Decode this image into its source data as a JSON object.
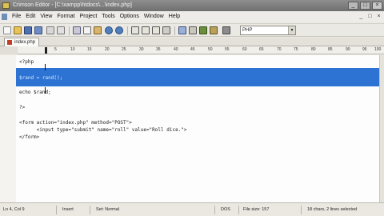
{
  "window": {
    "title": "Crimson Editor - [C:\\xampp\\htdocs\\...\\index.php]",
    "buttons": [
      "_",
      "□",
      "×"
    ]
  },
  "menu": {
    "items": [
      "File",
      "Edit",
      "View",
      "Format",
      "Project",
      "Tools",
      "Options",
      "Window",
      "Help"
    ],
    "mdi_buttons": [
      "_",
      "□",
      "×"
    ]
  },
  "toolbar": {
    "language": "PHP",
    "icons": [
      "new-file-icon",
      "open-folder-icon",
      "save-icon",
      "save-all-icon",
      "print-icon",
      "print-preview-icon",
      "cut-icon",
      "copy-icon",
      "paste-icon",
      "undo-icon",
      "redo-icon",
      "find-icon",
      "replace-icon",
      "find-next-icon",
      "go-to-icon",
      "word-wrap-icon",
      "column-mode-icon",
      "bookmark-icon",
      "toggle-icon",
      "run-icon"
    ]
  },
  "tabs": [
    {
      "label": "index.php",
      "active": true
    }
  ],
  "ruler": {
    "marks": [
      "5",
      "10",
      "15",
      "20",
      "25",
      "30",
      "35",
      "40",
      "45",
      "50",
      "55",
      "60",
      "65",
      "70",
      "75",
      "80",
      "85",
      "90",
      "95",
      "100"
    ]
  },
  "editor": {
    "lines": [
      "<?php",
      "",
      "$rand = rand();",
      "",
      "echo $rand;",
      "",
      "?>",
      "",
      "<form action=\"index.php\" method=\"POST\">",
      "      <input type=\"submit\" name=\"roll\" value=\"Roll dice.\">",
      "</form>"
    ],
    "selected_lines": [
      2,
      3
    ]
  },
  "status": {
    "position": "Ln 4, Col 9",
    "mode": "Insert",
    "set": "Set: Normal",
    "format": "DOS",
    "file_size": "File size: 157",
    "selection": "18 chars, 2 lines selected"
  },
  "colors": {
    "selection": "#2d73d3",
    "editor_bg": "#fdfdfd",
    "chrome_bg": "#ece9e4"
  }
}
